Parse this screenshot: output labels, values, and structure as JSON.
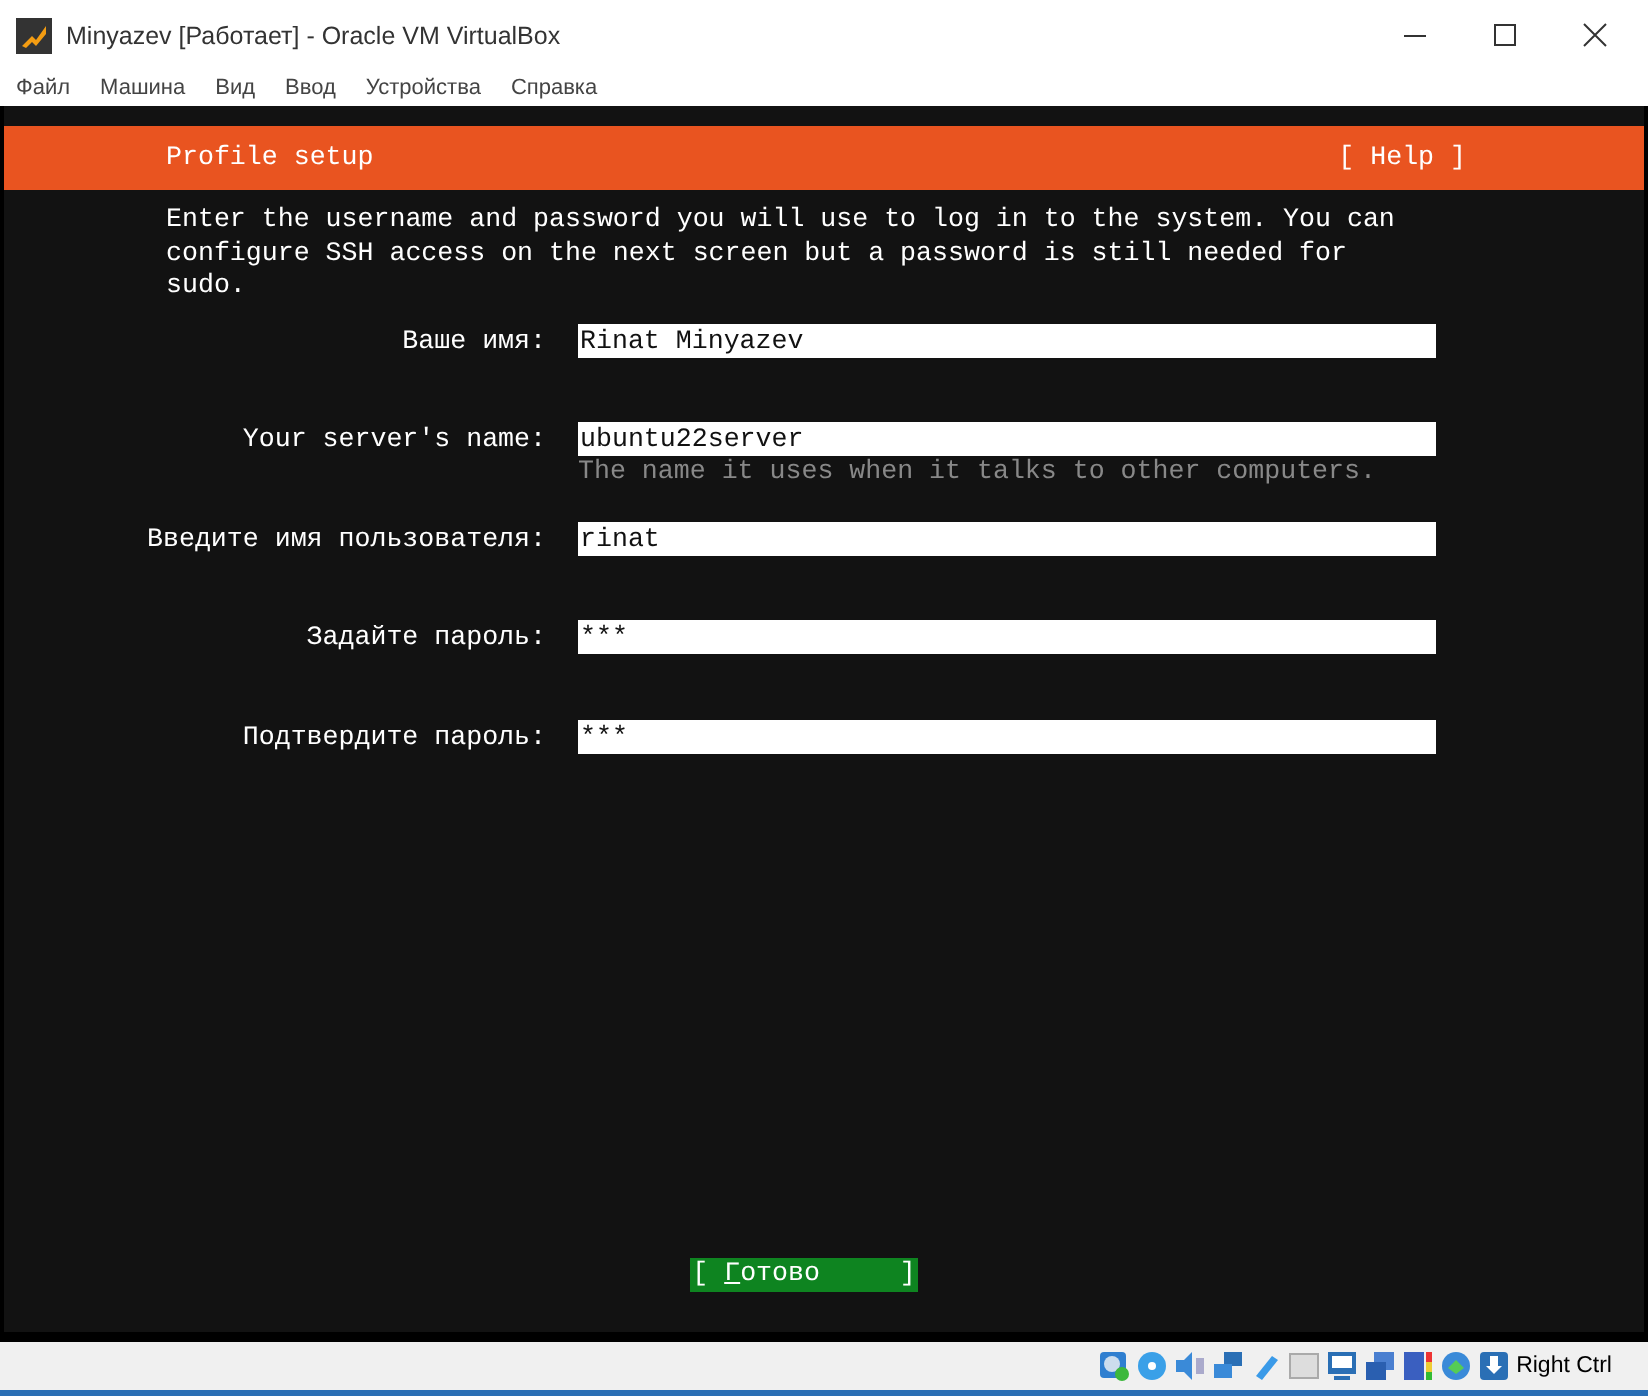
{
  "window": {
    "title": "Minyazev [Работает] - Oracle VM VirtualBox"
  },
  "menu": [
    "Файл",
    "Машина",
    "Вид",
    "Ввод",
    "Устройства",
    "Справка"
  ],
  "screen": {
    "header": {
      "title": "Profile setup",
      "help": "[ Help ]"
    },
    "intro": "Enter the username and password you will use to log in to the system. You can configure SSH access on the next screen but a password is still needed for\nsudo.",
    "fields": [
      {
        "label": "Ваше имя:",
        "value": "Rinat Minyazev"
      },
      {
        "label": "Your server's name:",
        "value": "ubuntu22server",
        "hint": "The name it uses when it talks to other computers."
      },
      {
        "label": "Введите имя пользователя:",
        "value": "rinat"
      },
      {
        "label": "Задайте пароль:",
        "value": "***"
      },
      {
        "label": "Подтвердите пароль:",
        "value": "***"
      }
    ],
    "button": {
      "label": "[ Готово     ]",
      "selected": true
    }
  },
  "status_bar": {
    "host_key": "Right Ctrl"
  }
}
